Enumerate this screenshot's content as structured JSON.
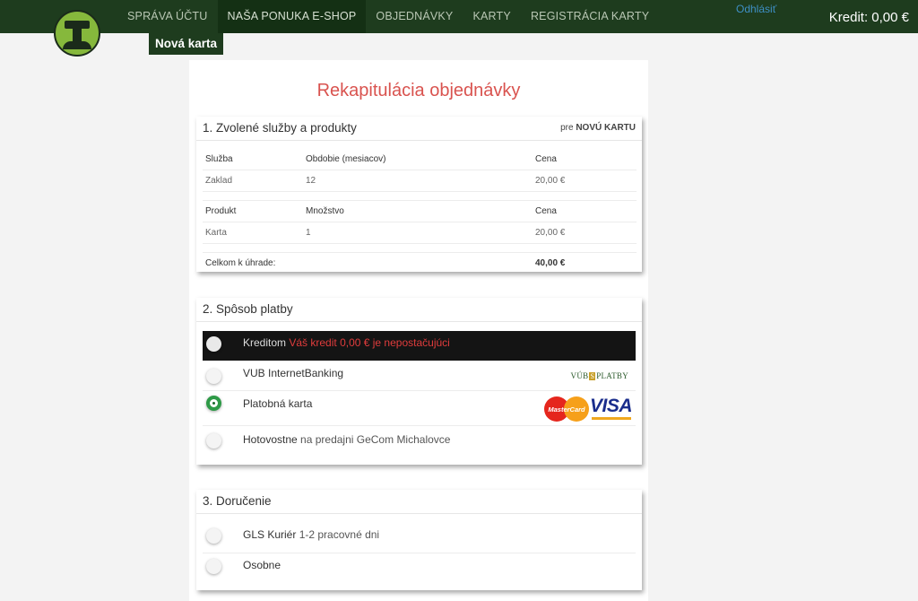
{
  "header": {
    "nav": [
      "SPRÁVA ÚČTU",
      "NAŠA PONUKA E-SHOP",
      "OBJEDNÁVKY",
      "KARTY",
      "REGISTRÁCIA KARTY"
    ],
    "active_nav_index": 1,
    "logout": "Odhlásiť",
    "credit": "Kredit: 0,00 €",
    "subtab": "Nová karta"
  },
  "page_title": "Rekapitulácia objednávky",
  "section1": {
    "title": "1. Zvolené služby a produkty",
    "for_prefix": "pre",
    "for_value": "NOVÚ KARTU",
    "service_head": [
      "Služba",
      "Obdobie (mesiacov)",
      "Cena"
    ],
    "service_row": [
      "Zaklad",
      "12",
      "20,00 €"
    ],
    "product_head": [
      "Produkt",
      "Množstvo",
      "Cena"
    ],
    "product_row": [
      "Karta",
      "1",
      "20,00 €"
    ],
    "total_label": "Celkom k úhrade:",
    "total_value": "40,00 €"
  },
  "section2": {
    "title": "2. Spôsob platby",
    "options": [
      {
        "label": "Kreditom",
        "note": "Váš kredit 0,00 € je nepostačujúci",
        "selected": false,
        "disabled": true
      },
      {
        "label": "VUB InternetBanking",
        "note": "",
        "selected": false,
        "logo": "VÚB PLATBY"
      },
      {
        "label": "Platobná karta",
        "note": "",
        "selected": true,
        "logos": [
          "MasterCard",
          "VISA"
        ]
      },
      {
        "label": "Hotovostne",
        "note": "na predajni GeCom Michalovce",
        "selected": false
      }
    ],
    "vub_logo_left": "VÚB",
    "vub_logo_box": "S",
    "vub_logo_right": "PLATBY",
    "mastercard": "MasterCard",
    "visa": "VISA"
  },
  "section3": {
    "title": "3. Doručenie",
    "options": [
      {
        "label": "GLS Kuriér",
        "note": "1-2 pracovné dni",
        "selected": false
      },
      {
        "label": "Osobne",
        "note": "",
        "selected": false
      }
    ]
  },
  "colors": {
    "topbar": "#1e3c1e",
    "title_red": "#d9534f",
    "radio_checked": "#2e9a47",
    "warning": "#e03c3c"
  }
}
